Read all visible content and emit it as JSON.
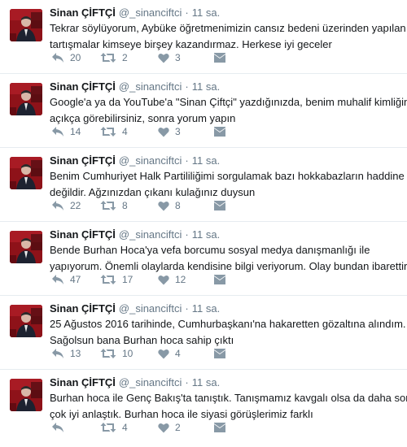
{
  "user": {
    "name": "Sinan ÇİFTÇİ",
    "handle": "@_sinanciftci"
  },
  "separator": "·",
  "icons": {
    "reply": "reply-icon",
    "retweet": "retweet-icon",
    "like": "heart-icon",
    "dm": "envelope-icon"
  },
  "colors": {
    "text": "#14171a",
    "muted": "#657786",
    "icon": "#8899a6",
    "avatar": "#a81b22"
  },
  "tweets": [
    {
      "time": "11 sa.",
      "lines": [
        "Tekrar söylüyorum, Aybüke öğretmenimizin cansız bedeni üzerinden yapılan bu",
        "tartışmalar kimseye birşey kazandırmaz. Herkese iyi geceler"
      ],
      "replies": "20",
      "retweets": "2",
      "likes": "3"
    },
    {
      "time": "11 sa.",
      "lines": [
        "Google'a ya da YouTube'a \"Sinan Çiftçi\" yazdığınızda, benim muhalif kimliğimi",
        "açıkça görebilirsiniz, sonra yorum yapın"
      ],
      "replies": "14",
      "retweets": "4",
      "likes": "3"
    },
    {
      "time": "11 sa.",
      "lines": [
        "Benim Cumhuriyet Halk Partililiğimi sorgulamak bazı hokkabazların haddine",
        "değildir. Ağzınızdan çıkanı kulağınız duysun"
      ],
      "replies": "22",
      "retweets": "8",
      "likes": "8"
    },
    {
      "time": "11 sa.",
      "lines": [
        "Bende Burhan Hoca'ya vefa borcumu sosyal medya danışmanlığı ile",
        "yapıyorum. Önemli olaylarda kendisine bilgi veriyorum. Olay bundan ibarettir"
      ],
      "replies": "47",
      "retweets": "17",
      "likes": "12"
    },
    {
      "time": "11 sa.",
      "lines": [
        "25 Ağustos 2016 tarihinde, Cumhurbaşkanı'na hakaretten gözaltına alındım.",
        "Sağolsun bana Burhan hoca sahip çıktı"
      ],
      "replies": "13",
      "retweets": "10",
      "likes": "4"
    },
    {
      "time": "11 sa.",
      "lines": [
        "Burhan hoca ile Genç Bakış'ta tanıştık. Tanışmamız kavgalı olsa da daha sonra",
        "çok iyi anlaştık. Burhan hoca ile siyasi görüşlerimiz farklı"
      ],
      "replies": "",
      "retweets": "4",
      "likes": "2"
    }
  ]
}
